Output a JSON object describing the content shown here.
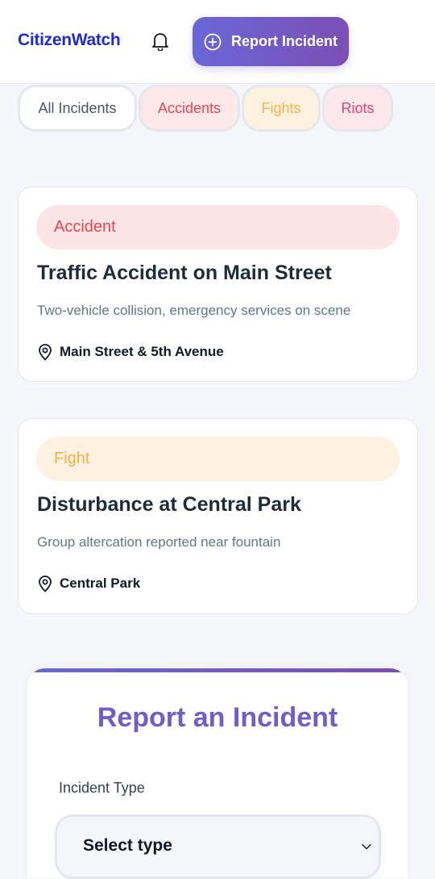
{
  "header": {
    "brand": "CitizenWatch",
    "report_button": "Report Incident"
  },
  "filters": [
    {
      "label": "All Incidents"
    },
    {
      "label": "Accidents"
    },
    {
      "label": "Fights"
    },
    {
      "label": "Riots"
    }
  ],
  "incidents": [
    {
      "badge": "Accident",
      "title": "Traffic Accident on Main Street",
      "description": "Two-vehicle collision, emergency services on scene",
      "location": "Main Street & 5th Avenue"
    },
    {
      "badge": "Fight",
      "title": "Disturbance at Central Park",
      "description": "Group altercation reported near fountain",
      "location": "Central Park"
    }
  ],
  "report_form": {
    "title": "Report an Incident",
    "type_label": "Incident Type",
    "type_value": "Select type"
  },
  "colors": {
    "brand": "#1d2bd0",
    "gradient_start": "#6a67d8",
    "gradient_end": "#7b4fb4",
    "accident": "#e8474e",
    "fight": "#f1b242",
    "riot": "#e84466"
  }
}
